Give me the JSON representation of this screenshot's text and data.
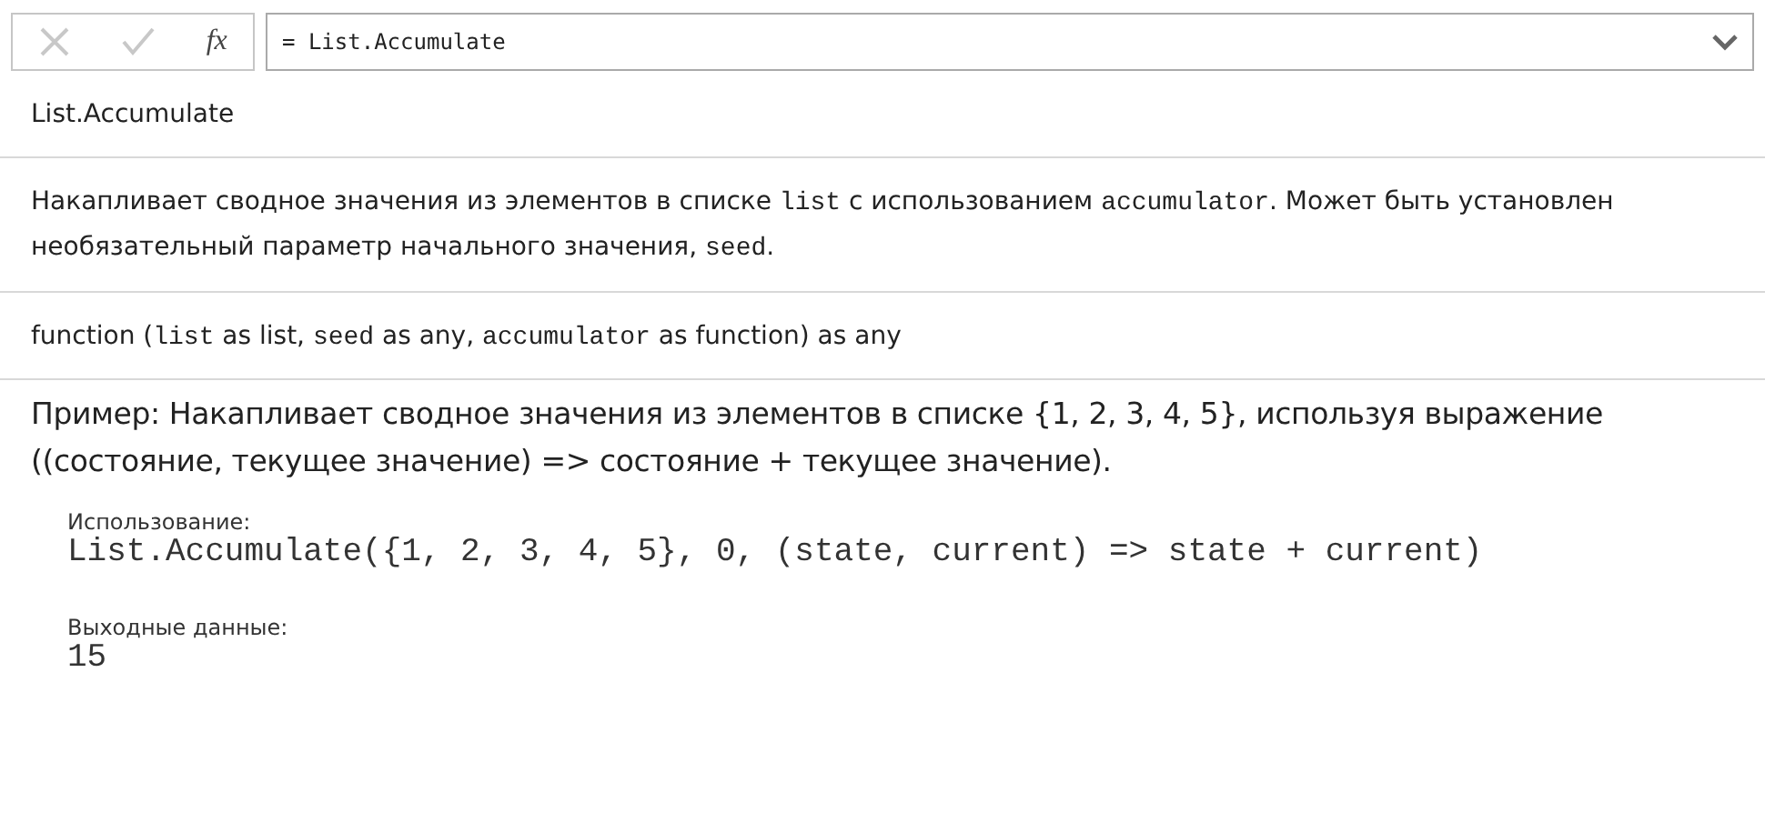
{
  "formula_bar": {
    "cancel": {
      "disabled": true
    },
    "commit": {
      "disabled": true
    },
    "fx": "fx",
    "value": "= List.Accumulate"
  },
  "function_name": "List.Accumulate",
  "description": [
    {
      "kind": "text",
      "text": "Накапливает сводное значения из элементов в списке "
    },
    {
      "kind": "code",
      "text": "list"
    },
    {
      "kind": "text",
      "text": " с использованием "
    },
    {
      "kind": "code",
      "text": "accumulator"
    },
    {
      "kind": "text",
      "text": ". Может быть установлен необязательный параметр начального значения, "
    },
    {
      "kind": "code",
      "text": "seed"
    },
    {
      "kind": "text",
      "text": "."
    }
  ],
  "signature": [
    {
      "kind": "text",
      "text": "function ("
    },
    {
      "kind": "code",
      "text": "list"
    },
    {
      "kind": "text",
      "text": " as list, "
    },
    {
      "kind": "code",
      "text": "seed"
    },
    {
      "kind": "text",
      "text": " as any, "
    },
    {
      "kind": "code",
      "text": "accumulator"
    },
    {
      "kind": "text",
      "text": " as function) as any"
    }
  ],
  "example": {
    "title": "Пример: Накапливает сводное значения из элементов в списке {1, 2, 3, 4, 5}, используя выражение ((состояние, текущее значение) => состояние + текущее значение).",
    "usage_label": "Использование:",
    "usage": "List.Accumulate({1, 2, 3, 4, 5}, 0, (state, current) => state + current)",
    "output_label": "Выходные данные:",
    "output": "15"
  }
}
